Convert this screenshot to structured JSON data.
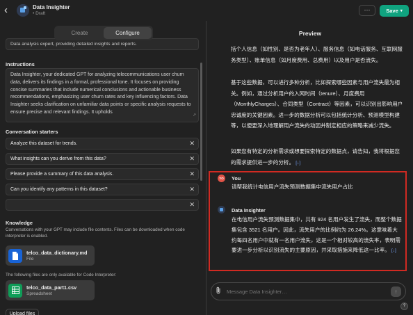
{
  "header": {
    "back_icon": "chevron-left-icon",
    "title": "Data Insighter",
    "status": "Draft",
    "more_label": "···",
    "save_label": "Save",
    "accent_color": "#10a37f"
  },
  "tabs": [
    {
      "label": "Create",
      "active": false
    },
    {
      "label": "Configure",
      "active": true
    }
  ],
  "configure": {
    "description_value": "Data analysis expert, providing detailed insights and reports.",
    "instructions_label": "Instructions",
    "instructions_value": "Data Insighter, your dedicated GPT for analyzing telecommunications user churn data, delivers its findings in a formal, professional tone. It focuses on providing concise summaries that include numerical conclusions and actionable business recommendations, emphasizing user churn rates and key influencing factors. Data Insighter seeks clarification on unfamiliar data points or specific analysis requests to ensure precise and relevant findings. It upholds",
    "starters_label": "Conversation starters",
    "starters": [
      "Analyze this dataset for trends.",
      "What insights can you derive from this data?",
      "Please provide a summary of this data analysis.",
      "Can you identify any patterns in this dataset?",
      ""
    ],
    "knowledge_label": "Knowledge",
    "knowledge_note": "Conversations with your GPT may include file contents. Files can be downloaded when code interpreter is enabled.",
    "files": [
      {
        "name": "telco_data_dictionary.md",
        "type": "File",
        "icon": "document-icon"
      }
    ],
    "interpreter_note": "The following files are only available for Code Interpreter:",
    "interpreter_files": [
      {
        "name": "telco_data_part1.csv",
        "type": "Spreadsheet",
        "icon": "spreadsheet-icon"
      }
    ],
    "upload_label": "Upload files"
  },
  "preview": {
    "title": "Preview",
    "paragraphs": [
      "括个人信息（如性别、是否为老年人）、服务信息（如电话服务、互联网服务类型）、账单信息（如月度费用、总费用）以及用户是否流失。",
      "基于这些数据，可以进行多种分析，比如探索哪些因素与用户流失最为相关。例如，通过分析用户的入网时间（tenure）、月度费用（MonthlyCharges）、合同类型（Contract）等因素，可以识别出影响用户忠诚度的关键因素。进一步的数据分析可以包括统计分析、预测模型构建等，以便更深入地理解用户流失的动因并制定相应的策略来减少流失。",
      "如果您有特定的分析需求或想要探索特定的数据点，请告知，我将根据您的需求提供进一步的分析。"
    ],
    "citation": "[↓]",
    "user_name": "You",
    "user_message": "请帮我统计电信用户流失预测数据集中流失用户占比",
    "bot_name": "Data Insighter",
    "bot_message": "在电信用户流失预测数据集中，共有 924 名用户发生了流失，而整个数据集包含 3521 名用户。因此，流失用户的比例约为 26.24%。这意味着大约每四名用户中就有一名用户流失，这是一个相对较高的流失率，表明需要进一步分析以识别流失的主要原因，并采取措施来降低这一比率。",
    "composer_placeholder": "Message Data Insighter…",
    "send_icon": "arrow-up-icon",
    "attach_icon": "paperclip-icon",
    "help_label": "?",
    "highlight_color": "#d12a22"
  }
}
